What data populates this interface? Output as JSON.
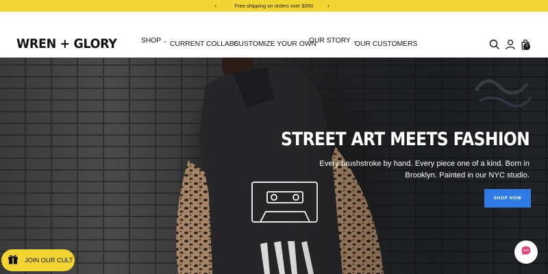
{
  "announcement": {
    "text": "Free shipping on orders over $350",
    "prev_icon": "chevron-left-icon",
    "next_icon": "chevron-right-icon"
  },
  "header": {
    "logo": "WREN + GLORY",
    "nav": [
      {
        "label": "SHOP",
        "has_dropdown": true
      },
      {
        "label": "CURRENT COLLABS",
        "has_dropdown": false
      },
      {
        "label": "CUSTOMIZE YOUR OWN",
        "has_dropdown": false
      },
      {
        "label": "OUR STORY",
        "has_dropdown": true
      },
      {
        "label": "OUR CUSTOMERS",
        "has_dropdown": false
      }
    ],
    "icons": [
      "search-icon",
      "account-icon",
      "cart-icon"
    ],
    "cart_count": "0"
  },
  "hero": {
    "title": "STREET ART MEETS FASHION",
    "subtitle": "Every brushstroke by hand. Every piece one of a kind. Born in Brooklyn. Painted in our NYC studio.",
    "cta_label": "SHOP NOW"
  },
  "floating": {
    "loyalty_label": "JOIN OUR CULT",
    "loyalty_icon": "gift-icon",
    "chat_icon": "chat-icon"
  },
  "colors": {
    "announcement_bg": "#f3d532",
    "cta_bg": "#2f7be6",
    "chat_accent": "#e2457d"
  }
}
